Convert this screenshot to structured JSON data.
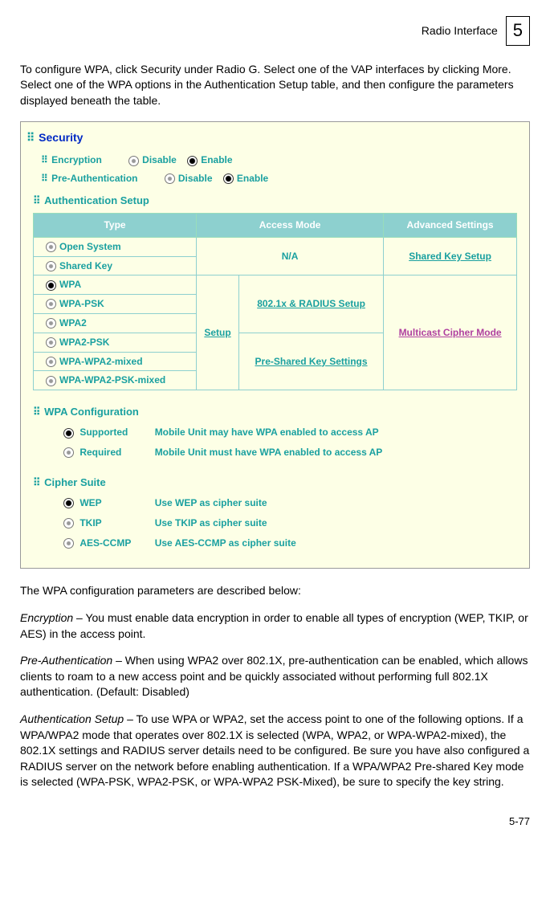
{
  "header": {
    "title": "Radio Interface",
    "chapter": "5"
  },
  "intro": "To configure WPA, click Security under Radio G. Select one of the VAP interfaces by clicking More. Select one of the WPA options in the Authentication Setup table, and then configure the parameters displayed beneath the table.",
  "screenshot": {
    "section_title": "Security",
    "encryption": {
      "label": "Encryption",
      "opt1": "Disable",
      "opt2": "Enable"
    },
    "preauth": {
      "label": "Pre-Authentication",
      "opt1": "Disable",
      "opt2": "Enable"
    },
    "authsetup_label": "Authentication Setup",
    "table": {
      "h1": "Type",
      "h2": "Access Mode",
      "h3": "Advanced Settings",
      "types": [
        "Open System",
        "Shared Key",
        "WPA",
        "WPA-PSK",
        "WPA2",
        "WPA2-PSK",
        "WPA-WPA2-mixed",
        "WPA-WPA2-PSK-mixed"
      ],
      "na": "N/A",
      "shared_key_setup": "Shared Key Setup",
      "setup": "Setup",
      "radius_setup": "802.1x & RADIUS Setup",
      "psk_settings": "Pre-Shared Key Settings",
      "multicast": "Multicast Cipher Mode"
    },
    "wpa_config": {
      "label": "WPA Configuration",
      "supported": {
        "name": "Supported",
        "desc": "Mobile Unit may have WPA enabled to access AP"
      },
      "required": {
        "name": "Required",
        "desc": "Mobile Unit must have WPA enabled to access AP"
      }
    },
    "cipher": {
      "label": "Cipher Suite",
      "wep": {
        "name": "WEP",
        "desc": "Use WEP as cipher suite"
      },
      "tkip": {
        "name": "TKIP",
        "desc": "Use TKIP as cipher suite"
      },
      "aes": {
        "name": "AES-CCMP",
        "desc": "Use AES-CCMP as cipher suite"
      }
    }
  },
  "desc_intro": "The WPA configuration parameters are described below:",
  "p_encryption_label": "Encryption",
  "p_encryption": " – You must enable data encryption in order to enable all types of encryption (WEP, TKIP, or AES) in the access point.",
  "p_preauth_label": "Pre-Authentication",
  "p_preauth": " – When using WPA2 over 802.1X, pre-authentication can be enabled, which allows clients to roam to a new access point and be quickly associated without performing full 802.1X authentication. (Default: Disabled)",
  "p_authsetup_label": "Authentication Setup",
  "p_authsetup": " –  To use WPA or WPA2, set the access point to one of the following options. If a WPA/WPA2 mode that operates over 802.1X is selected (WPA, WPA2, or WPA-WPA2-mixed), the 802.1X settings and RADIUS server details need to be configured. Be sure you have also configured a RADIUS server on the network before enabling authentication. If a WPA/WPA2 Pre-shared Key mode is selected (WPA-PSK, WPA2-PSK, or WPA-WPA2 PSK-Mixed), be sure to specify the key string.",
  "page_num": "5-77"
}
